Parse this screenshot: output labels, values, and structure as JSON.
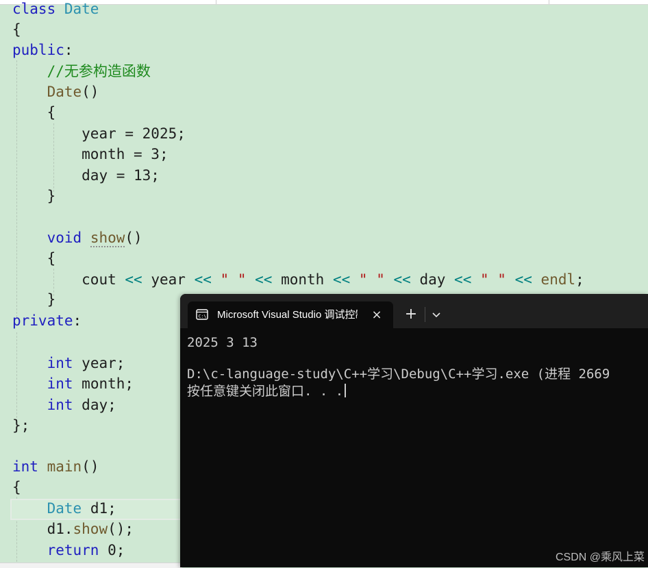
{
  "editor": {
    "lines": {
      "class_line": {
        "kw": "class",
        "name": "Date"
      },
      "open_brace_1": "{",
      "public_label": "public",
      "colon": ":",
      "comment": "//无参构造函数",
      "ctor_name": "Date",
      "parens": "()",
      "open_brace_2": "{",
      "year_assign": "year = 2025;",
      "month_assign": "month = 3;",
      "day_assign": "day = 13;",
      "close_brace_2": "}",
      "void_kw": "void",
      "show_name": "show",
      "open_brace_3": "{",
      "cout": "cout",
      "op": "<<",
      "year": "year",
      "space_str": "\" \"",
      "month": "month",
      "day": "day",
      "endl": "endl",
      "semicolon": ";",
      "close_brace_3": "}",
      "private_label": "private",
      "int_kw": "int",
      "year_decl": "year;",
      "month_decl": "month;",
      "day_decl": "day;",
      "class_end": "};",
      "main_name": "main",
      "open_brace_4": "{",
      "d1_decl": "d1;",
      "d1_call_obj": "d1.",
      "d1_call_fn": "show",
      "d1_call_end": "();",
      "return_kw": "return",
      "return_val": "0;"
    }
  },
  "console": {
    "tab_title": "Microsoft Visual Studio 调试控制台",
    "tab_close_icon": "×",
    "new_tab_icon": "+",
    "output": [
      "2025 3 13",
      "D:\\c-language-study\\C++学习\\Debug\\C++学习.exe (进程 2669",
      "按任意键关闭此窗口. . ."
    ]
  },
  "watermark": "CSDN @乘风上菜",
  "colors": {
    "editor_bg": "#cfe8d3",
    "keyword": "#1f1fc0",
    "type": "#2b91af",
    "function": "#6f5a2e",
    "comment": "#1f8a1f",
    "operator": "#008080",
    "string": "#b01818",
    "console_bg": "#0c0c0c"
  }
}
